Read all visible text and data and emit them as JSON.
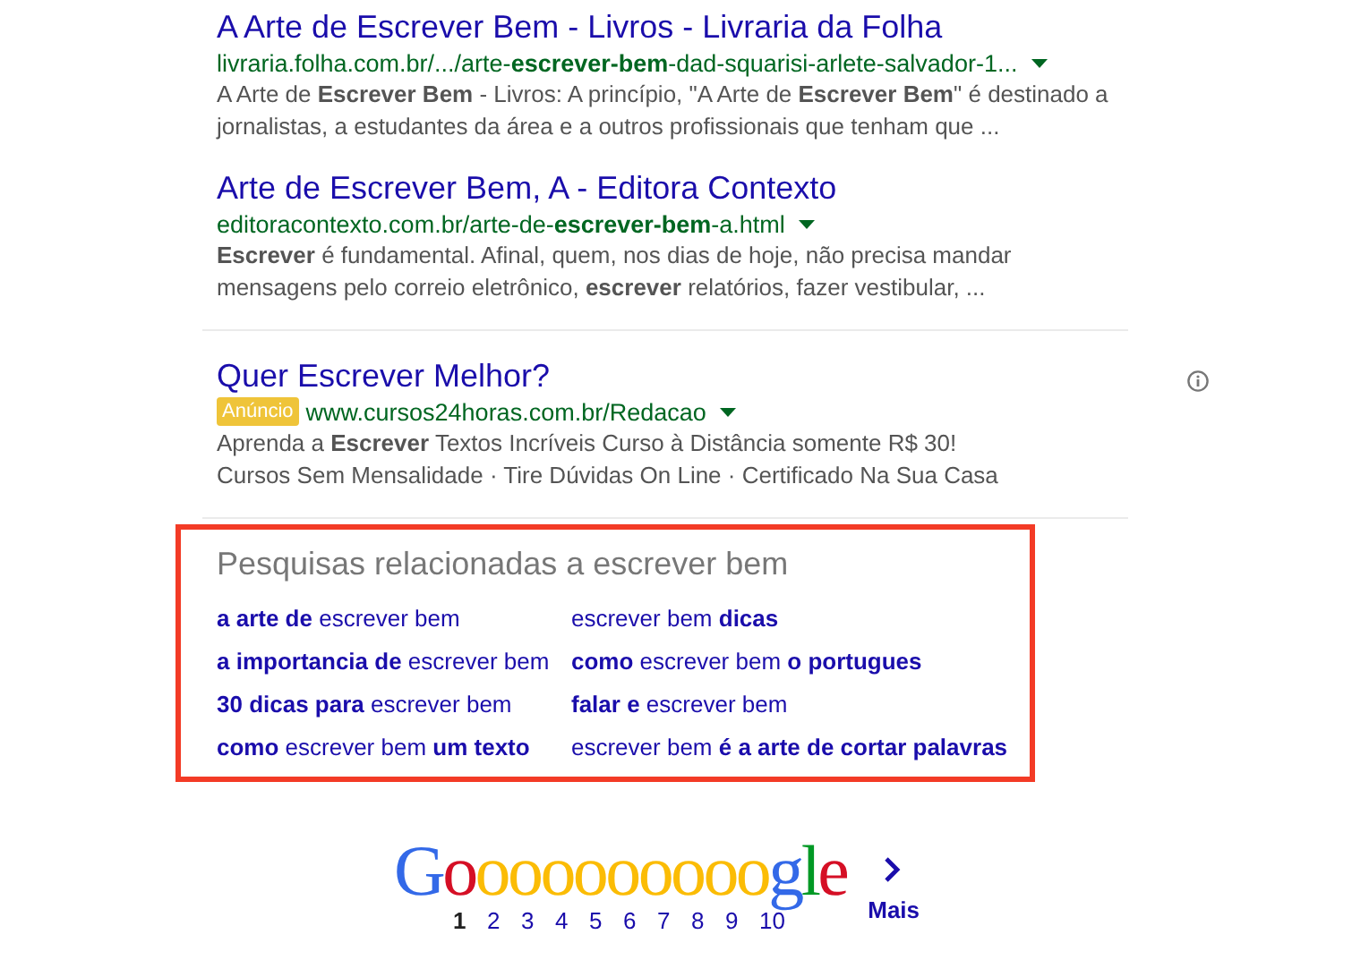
{
  "results": [
    {
      "kind": "organic",
      "title": "A Arte de Escrever Bem - Livros - Livraria da Folha",
      "url": "livraria.folha.com.br/.../arte-**escrever-bem**-dad-squarisi-arlete-salvador-1...",
      "snippet": [
        "A Arte de **Escrever Bem** - Livros: A princípio, \"A Arte de **Escrever Bem**\" é destinado a",
        "jornalistas, a estudantes da área e a outros profissionais que tenham que ..."
      ]
    },
    {
      "kind": "organic",
      "title": "Arte de Escrever Bem, A - Editora Contexto",
      "url": "editoracontexto.com.br/arte-de-**escrever-bem**-a.html",
      "snippet": [
        "**Escrever** é fundamental. Afinal, quem, nos dias de hoje, não precisa mandar",
        "mensagens pelo correio eletrônico, **escrever** relatórios, fazer vestibular, ..."
      ]
    },
    {
      "kind": "ad",
      "title": "Quer Escrever Melhor?",
      "badge": "Anúncio",
      "url": "www.cursos24horas.com.br/Redacao",
      "snippet": [
        "Aprenda a **Escrever** Textos Incríveis Curso à Distância somente R$ 30!",
        "Cursos Sem Mensalidade · Tire Dúvidas On Line · Certificado Na Sua Casa"
      ]
    }
  ],
  "related": {
    "heading": "Pesquisas relacionadas a escrever bem",
    "links": [
      "**a arte de** escrever bem",
      "escrever bem **dicas**",
      "**a importancia de** escrever bem",
      "**como** escrever bem **o portugues**",
      "**30 dicas para** escrever bem",
      "**falar e** escrever bem",
      "**como** escrever bem **um texto**",
      "escrever bem **é a arte de cortar palavras**"
    ]
  },
  "pagination": {
    "logo": [
      {
        "letter": "G",
        "color": "#3369e8"
      },
      {
        "letter": "o",
        "color": "#d50f25"
      },
      {
        "letter": "o",
        "color": "#fbbc05"
      },
      {
        "letter": "o",
        "color": "#fbbc05"
      },
      {
        "letter": "o",
        "color": "#fbbc05"
      },
      {
        "letter": "o",
        "color": "#fbbc05"
      },
      {
        "letter": "o",
        "color": "#fbbc05"
      },
      {
        "letter": "o",
        "color": "#fbbc05"
      },
      {
        "letter": "o",
        "color": "#fbbc05"
      },
      {
        "letter": "o",
        "color": "#fbbc05"
      },
      {
        "letter": "o",
        "color": "#fbbc05"
      },
      {
        "letter": "g",
        "color": "#3369e8"
      },
      {
        "letter": "l",
        "color": "#009925"
      },
      {
        "letter": "e",
        "color": "#d50f25"
      }
    ],
    "pages": [
      {
        "label": "1",
        "selected": true
      },
      {
        "label": "2",
        "selected": false
      },
      {
        "label": "3",
        "selected": false
      },
      {
        "label": "4",
        "selected": false
      },
      {
        "label": "5",
        "selected": false
      },
      {
        "label": "6",
        "selected": false
      },
      {
        "label": "7",
        "selected": false
      },
      {
        "label": "8",
        "selected": false
      },
      {
        "label": "9",
        "selected": false
      },
      {
        "label": "10",
        "selected": false
      }
    ],
    "next": "Mais"
  }
}
